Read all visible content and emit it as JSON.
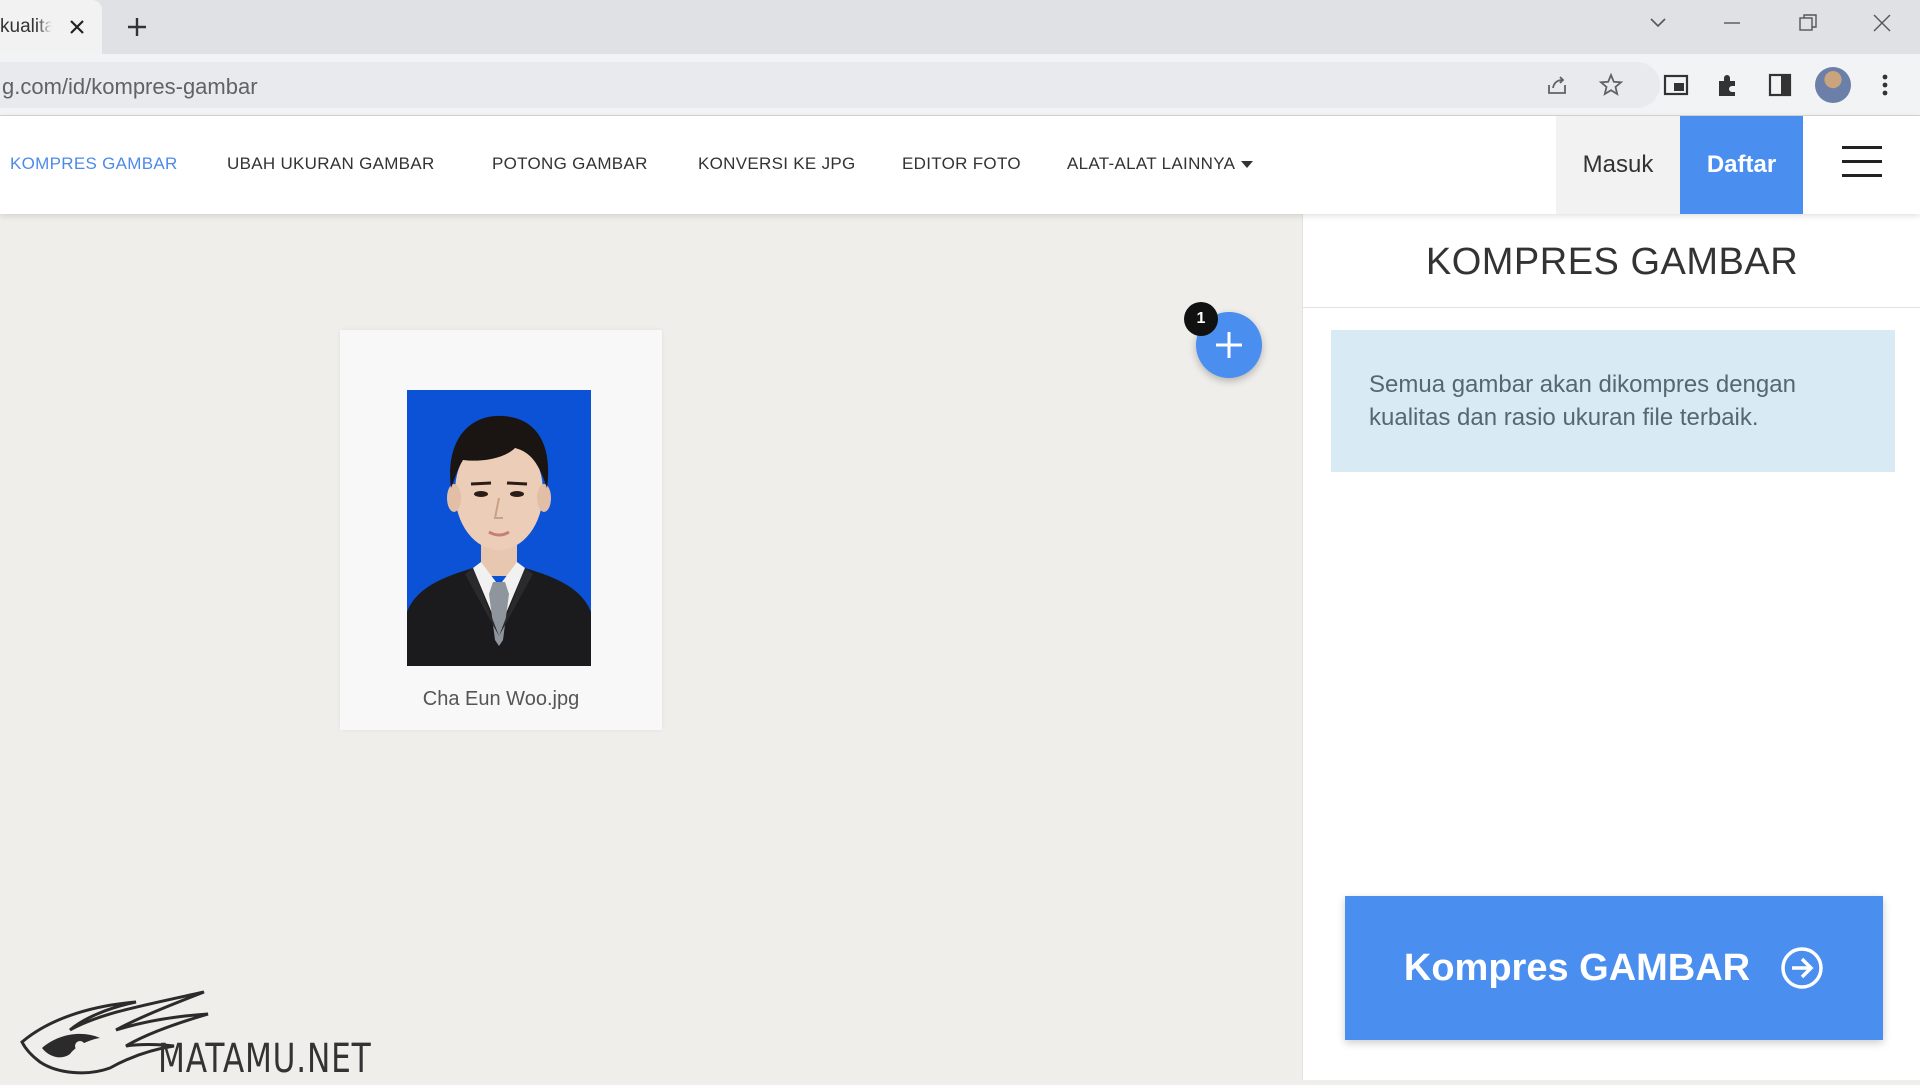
{
  "browser": {
    "tab_title": "kualitas",
    "url": "g.com/id/kompres-gambar",
    "toolbar_icons": [
      "share-icon",
      "star-icon",
      "picture-in-picture-icon",
      "extensions-icon",
      "sidebar-icon",
      "profile-avatar",
      "more-vert-icon"
    ],
    "window_controls": [
      "chevron-down-icon",
      "minimize-icon",
      "restore-icon",
      "close-icon"
    ]
  },
  "nav": {
    "items": [
      {
        "label": "KOMPRES GAMBAR",
        "active": true
      },
      {
        "label": "UBAH UKURAN GAMBAR",
        "active": false
      },
      {
        "label": "POTONG GAMBAR",
        "active": false
      },
      {
        "label": "KONVERSI KE JPG",
        "active": false
      },
      {
        "label": "EDITOR FOTO",
        "active": false
      },
      {
        "label": "ALAT-ALAT LAINNYA",
        "active": false
      }
    ],
    "login_label": "Masuk",
    "signup_label": "Daftar"
  },
  "workspace": {
    "file": {
      "name": "Cha Eun Woo.jpg"
    },
    "file_count_badge": "1"
  },
  "watermark": {
    "text": "MATAMU.NET"
  },
  "panel": {
    "title": "KOMPRES GAMBAR",
    "info": "Semua gambar akan dikompres dengan kualitas dan rasio ukuran file terbaik.",
    "action_label": "Kompres GAMBAR"
  },
  "colors": {
    "accent": "#4a8ef0",
    "nav_active": "#4d8be8",
    "info_bg": "#d8ebf5",
    "workspace_bg": "#efeeea"
  }
}
